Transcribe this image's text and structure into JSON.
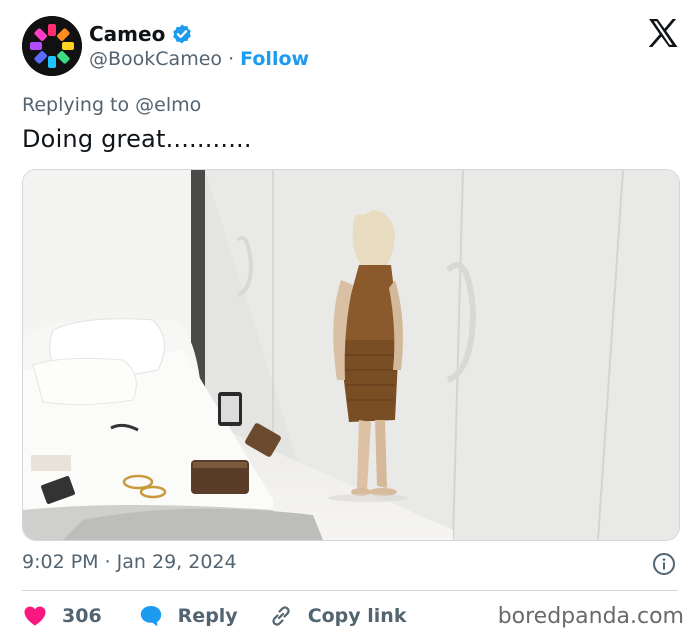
{
  "author": {
    "name": "Cameo",
    "handle": "@BookCameo",
    "separator": "·",
    "follow_label": "Follow"
  },
  "tweet": {
    "replying_to": "Replying to @elmo",
    "text": "Doing great...........",
    "timestamp": "9:02 PM · Jan 29, 2024",
    "media_description": "photo-woman-standing-facing-wall-beside-bed"
  },
  "actions": {
    "likes": "306",
    "reply_label": "Reply",
    "copy_link_label": "Copy link"
  },
  "watermark": "boredpanda.com",
  "colors": {
    "accent": "#1d9bf0",
    "like": "#f91880",
    "muted": "#536471",
    "text": "#0f1419"
  },
  "icons": [
    "cameo-logo-icon",
    "verified-badge-icon",
    "x-logo-icon",
    "info-icon",
    "heart-icon",
    "reply-bubble-icon",
    "link-icon"
  ]
}
